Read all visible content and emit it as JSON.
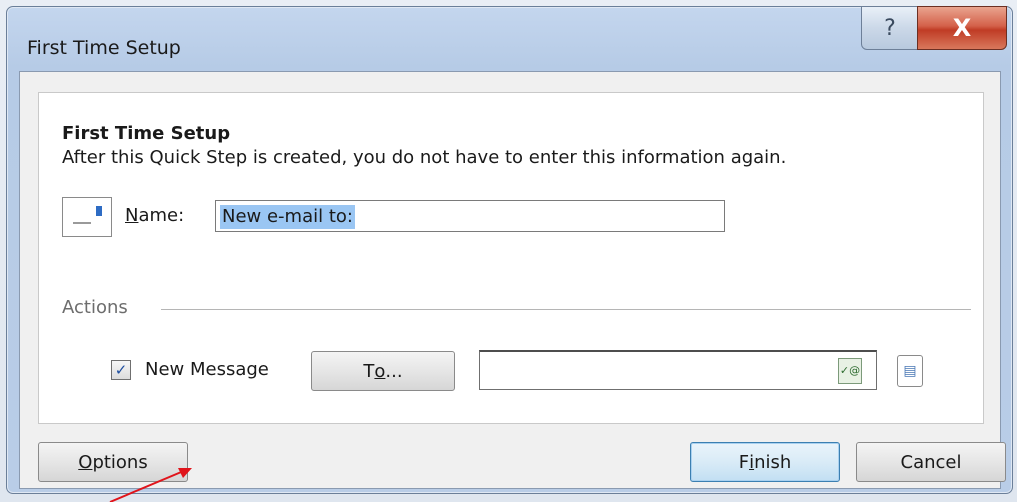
{
  "window": {
    "title": "First Time Setup",
    "help_glyph": "?",
    "close_glyph": "X"
  },
  "content": {
    "heading": "First Time Setup",
    "description": "After this Quick Step is created, you do not have to enter this information again.",
    "name_label_accel": "N",
    "name_label_rest": "ame:",
    "name_value": "New e-mail to:"
  },
  "actions": {
    "section_label": "Actions",
    "items": [
      {
        "label": "New Message",
        "checked": true,
        "to_button_prefix": "T",
        "to_button_accel": "o",
        "to_button_suffix": "...",
        "to_value": ""
      }
    ]
  },
  "footer": {
    "options_accel": "O",
    "options_rest": "ptions",
    "finish_pre": "F",
    "finish_accel": "i",
    "finish_post": "nish",
    "cancel_label": "Cancel"
  },
  "icons": {
    "quickstep_icon": "mail-template-icon",
    "address_check_icon": "check-names-icon",
    "address_book_icon": "address-book-icon",
    "checkbox_glyph": "✓"
  },
  "colors": {
    "selection": "#9ac6f3",
    "close": "#c03c25",
    "annotation_arrow": "#e0141b"
  }
}
